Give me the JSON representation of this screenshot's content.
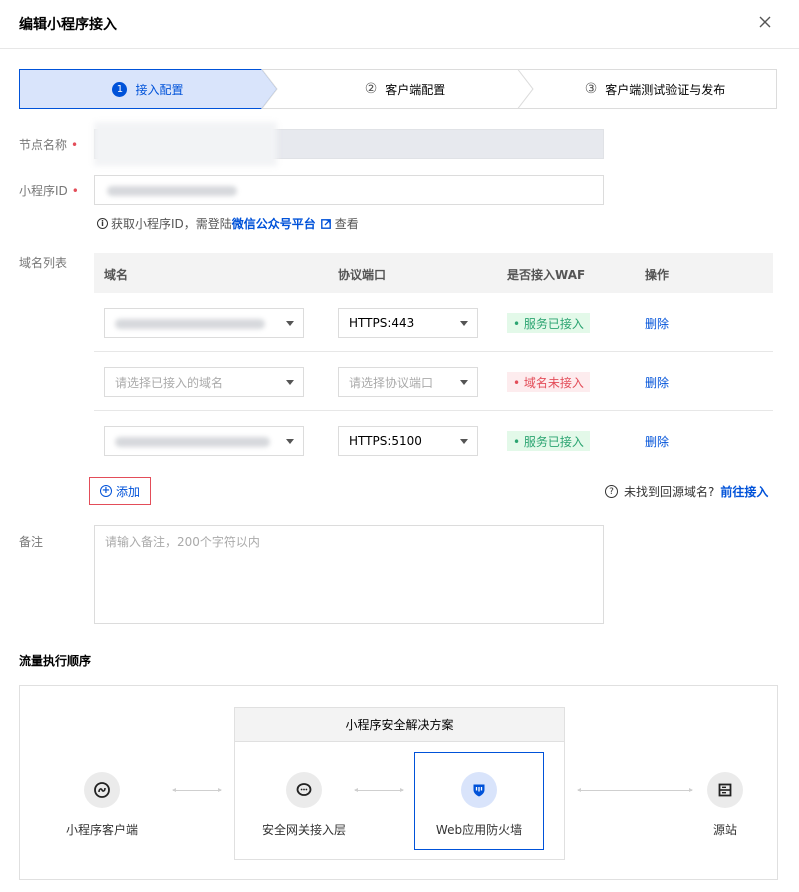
{
  "dialog": {
    "title": "编辑小程序接入"
  },
  "steps": [
    {
      "num": "1",
      "label": "接入配置"
    },
    {
      "num": "②",
      "label": "客户端配置"
    },
    {
      "num": "③",
      "label": "客户端测试验证与发布"
    }
  ],
  "form": {
    "node_name_label": "节点名称",
    "appid_label": "小程序ID",
    "required_mark": "•",
    "hint_prefix": "获取小程序ID，需登陆",
    "hint_link": "微信公众号平台",
    "hint_suffix": "查看",
    "domain_list_label": "域名列表",
    "remark_label": "备注",
    "remark_placeholder": "请输入备注，200个字符以内"
  },
  "table": {
    "headers": [
      "域名",
      "协议端口",
      "是否接入WAF",
      "操作"
    ],
    "rows": [
      {
        "domain": "",
        "port": "HTTPS:443",
        "status": "• 服务已接入",
        "action": "删除"
      },
      {
        "domain_placeholder": "请选择已接入的域名",
        "port_placeholder": "请选择协议端口",
        "status": "• 域名未接入",
        "action": "删除"
      },
      {
        "domain": "",
        "port": "HTTPS:5100",
        "status": "• 服务已接入",
        "action": "删除"
      }
    ]
  },
  "add_button": "添加",
  "not_found": {
    "text": "未找到回源域名?",
    "link": "前往接入"
  },
  "flow": {
    "title": "流量执行顺序",
    "solution_title": "小程序安全解决方案",
    "nodes": [
      "小程序客户端",
      "安全网关接入层",
      "Web应用防火墙",
      "源站"
    ]
  },
  "colors": {
    "primary": "#0052d9",
    "success": "#2ba471",
    "danger": "#e34d59",
    "step_active_bg": "#d9e4fb"
  }
}
